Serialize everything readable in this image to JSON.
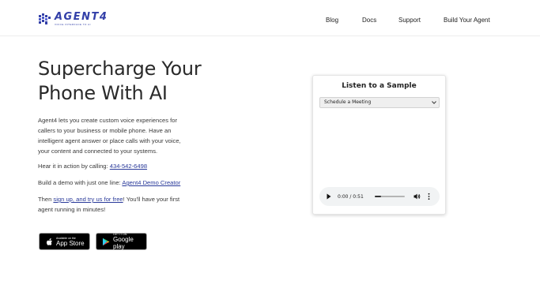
{
  "brand": {
    "name": "AGENT4",
    "tagline": "VOICE INTERFACE TO AI",
    "accent": "#3340a8"
  },
  "nav": [
    {
      "label": "Blog"
    },
    {
      "label": "Docs"
    },
    {
      "label": "Support"
    },
    {
      "label": "Build Your Agent"
    }
  ],
  "hero": {
    "title_line1": "Supercharge Your",
    "title_line2": "Phone With AI",
    "intro": "Agent4 lets you create custom voice experiences for callers to your business or mobile phone. Have an intelligent agent answer or place calls with your voice, your content and connected to your systems.",
    "call_prefix": "Hear it in action by calling: ",
    "call_number": "434-542-6498",
    "demo_prefix": "Build a demo with just one line: ",
    "demo_link": "Agent4 Demo Creator",
    "signup_prefix": "Then ",
    "signup_link": "sign up, and try us for free",
    "signup_suffix": "! You'll have your first agent running in minutes!"
  },
  "stores": {
    "apple_small": "Available on the",
    "apple_big": "App Store",
    "google_small": "GET IT ON",
    "google_big": "Google play"
  },
  "sample": {
    "title": "Listen to a Sample",
    "selected_option": "Schedule a Meeting",
    "time_display": "0:00 / 0:51",
    "progress": 0.0
  },
  "icons": {
    "logo": "brain-circuit-icon",
    "play": "play-icon",
    "volume": "volume-icon",
    "more": "more-vertical-icon",
    "apple": "apple-icon",
    "google": "google-play-icon"
  }
}
